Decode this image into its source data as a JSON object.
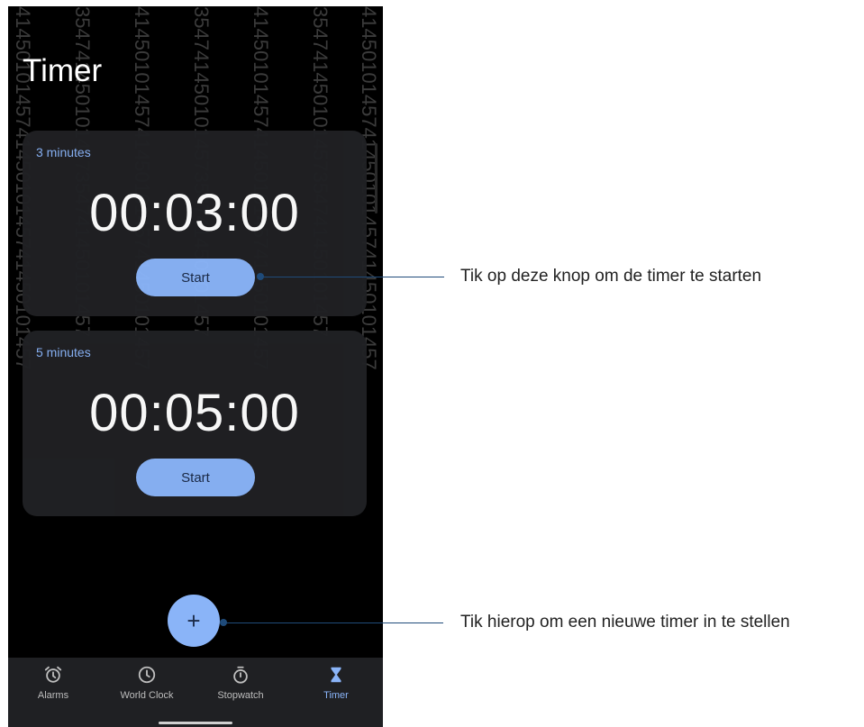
{
  "app": {
    "title": "Timer"
  },
  "timers": [
    {
      "label": "3 minutes",
      "time": "00:03:00",
      "start_label": "Start"
    },
    {
      "label": "5 minutes",
      "time": "00:05:00",
      "start_label": "Start"
    }
  ],
  "fab": {
    "icon": "plus-icon",
    "glyph": "+"
  },
  "nav": {
    "items": [
      {
        "label": "Alarms",
        "icon": "alarm-icon",
        "active": false
      },
      {
        "label": "World Clock",
        "icon": "clock-icon",
        "active": false
      },
      {
        "label": "Stopwatch",
        "icon": "stopwatch-icon",
        "active": false
      },
      {
        "label": "Timer",
        "icon": "hourglass-icon",
        "active": true
      }
    ]
  },
  "callouts": {
    "start": "Tik op deze knop om de timer te starten",
    "add": "Tik hierop om een nieuwe timer in te stellen"
  },
  "colors": {
    "accent": "#8ab4f8",
    "background": "#000000",
    "card": "#202124"
  }
}
